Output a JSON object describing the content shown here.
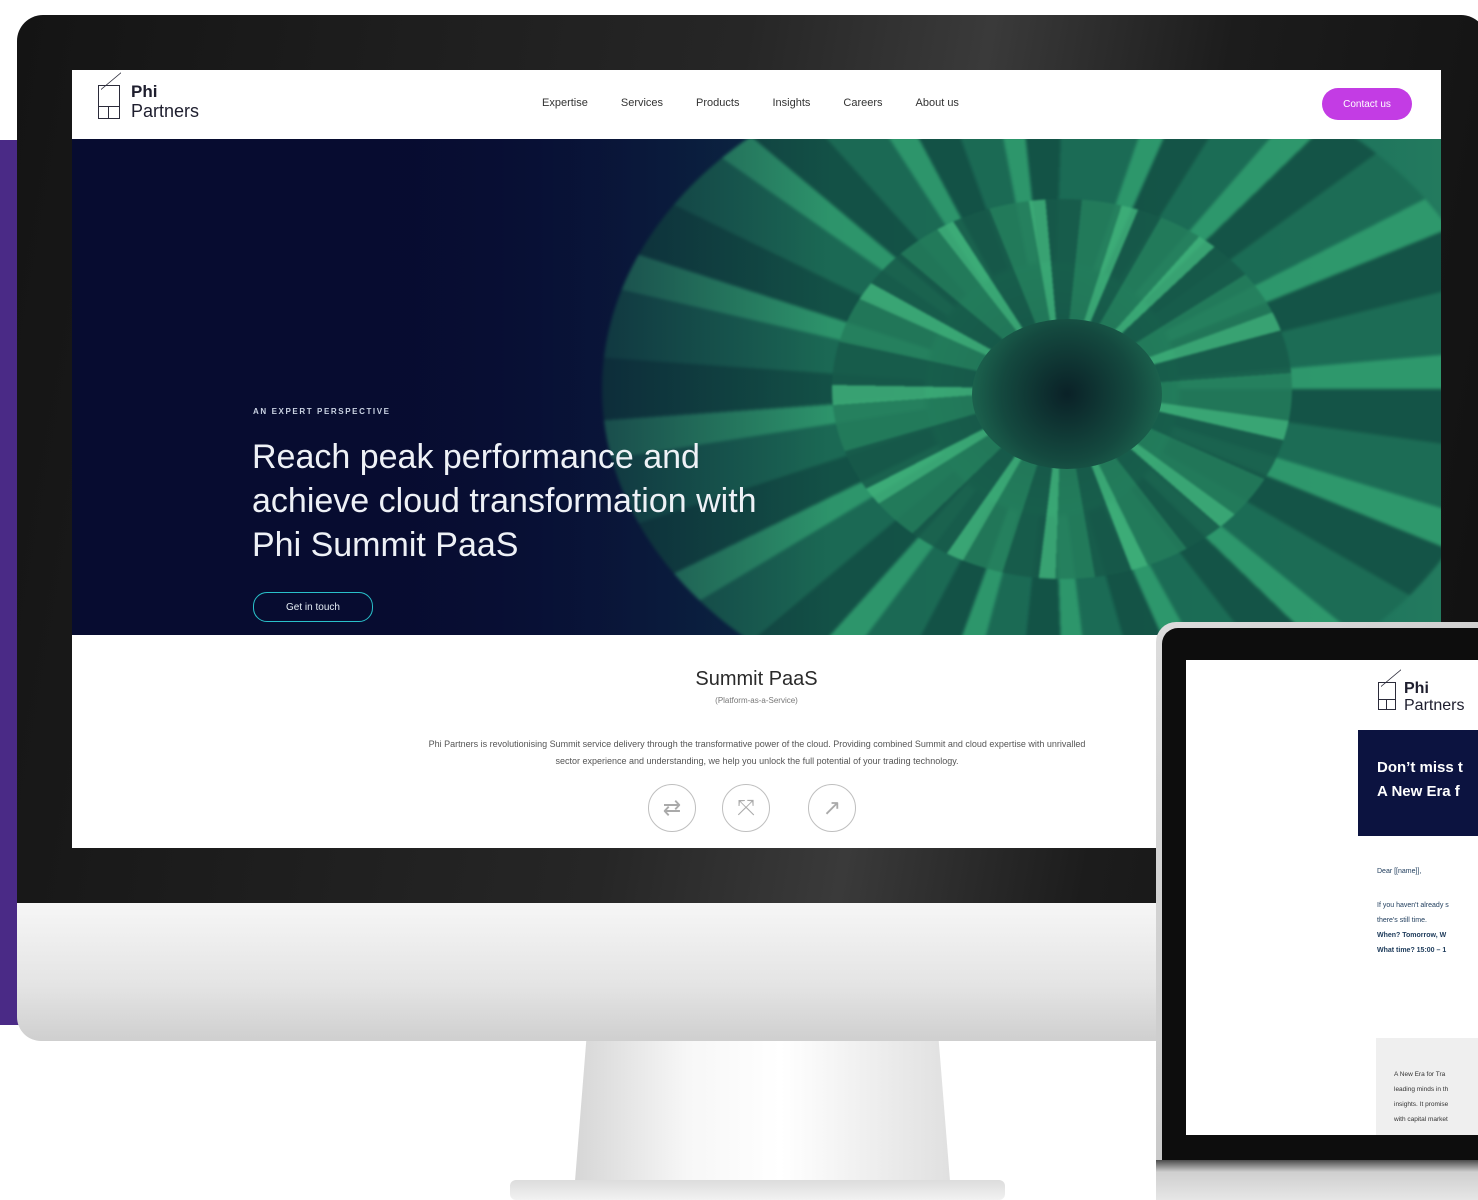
{
  "site": {
    "logo": {
      "line1": "Phi",
      "line2": "Partners"
    },
    "nav": {
      "items": [
        {
          "label": "Expertise"
        },
        {
          "label": "Services"
        },
        {
          "label": "Products"
        },
        {
          "label": "Insights"
        },
        {
          "label": "Careers"
        },
        {
          "label": "About us"
        }
      ],
      "contact_label": "Contact us"
    },
    "hero": {
      "eyebrow": "AN EXPERT PERSPECTIVE",
      "headline": "Reach peak performance and achieve cloud transformation with Phi Summit PaaS",
      "button_label": "Get in touch"
    },
    "summit": {
      "title": "Summit PaaS",
      "subtitle": "(Platform-as-a-Service)",
      "body": "Phi Partners is revolutionising Summit service delivery through the transformative power of the cloud. Providing combined Summit and cloud expertise with unrivalled sector experience and understanding, we help you unlock the full potential of your trading technology.",
      "icons": [
        "exchange-arrows-icon",
        "expand-arrows-icon",
        "growth-chart-icon"
      ]
    }
  },
  "email": {
    "logo": {
      "line1": "Phi",
      "line2": "Partners"
    },
    "banner_line1": "Don’t miss t",
    "banner_line2": "A New Era f",
    "greeting": "Dear [[name]],",
    "line1": "If you haven't already s",
    "line2": "there's still time.",
    "when": "When? Tomorrow, W",
    "what_time": "What time? 15:00 – 1",
    "box_lines": [
      "A New Era for Tra",
      "leading minds in th",
      "insights. It promise",
      "with capital market"
    ]
  },
  "colors": {
    "accent": "#c33ce4",
    "hero_bg": "#080d33",
    "hero_button_border": "#29c0c9",
    "side_band": "#4a2a86"
  }
}
